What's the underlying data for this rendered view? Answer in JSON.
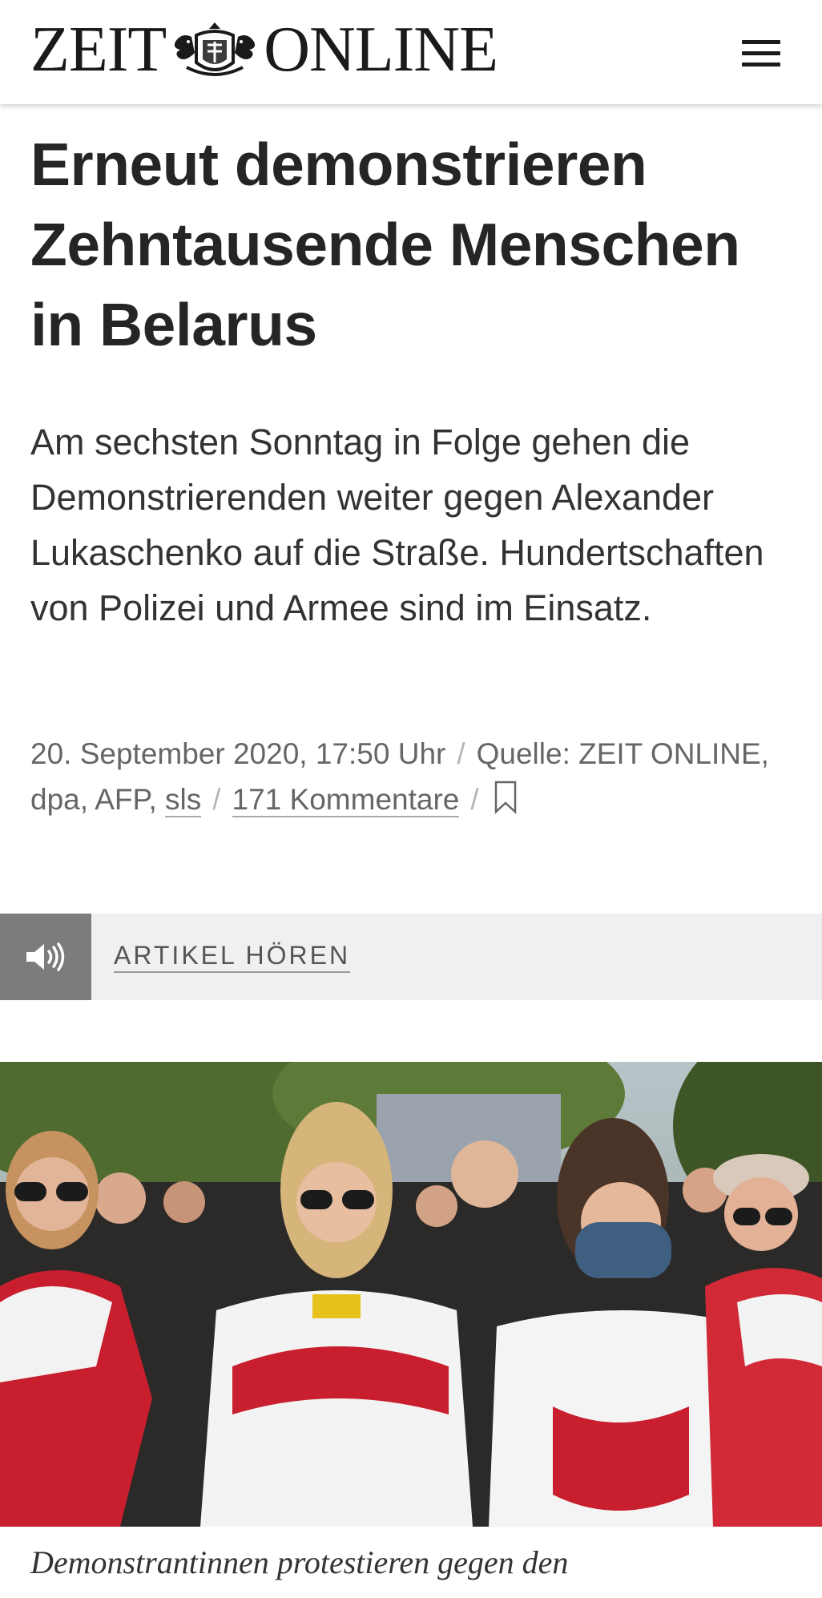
{
  "header": {
    "logo_left": "ZEIT",
    "logo_right": "ONLINE"
  },
  "article": {
    "title": "Erneut demonstrieren Zehntausende Menschen in Belarus",
    "summary": "Am sechsten Sonntag in Folge gehen die Demonstrierenden weiter gegen Alexander Lukaschenko auf die Straße. Hundertschaften von Polizei und Armee sind im Einsatz.",
    "meta": {
      "date": "20. September 2020, 17:50 Uhr",
      "source": "Quelle: ZEIT ONLINE, dpa, AFP,",
      "author": "sls",
      "comments": "171 Kommentare"
    },
    "listen_label": "ARTIKEL HÖREN",
    "caption": "Demonstrantinnen protestieren gegen den"
  },
  "colors": {
    "text": "#252525",
    "meta": "#666666",
    "listen_bar": "#f0f0f2",
    "speaker_block": "#7c7c7c"
  }
}
